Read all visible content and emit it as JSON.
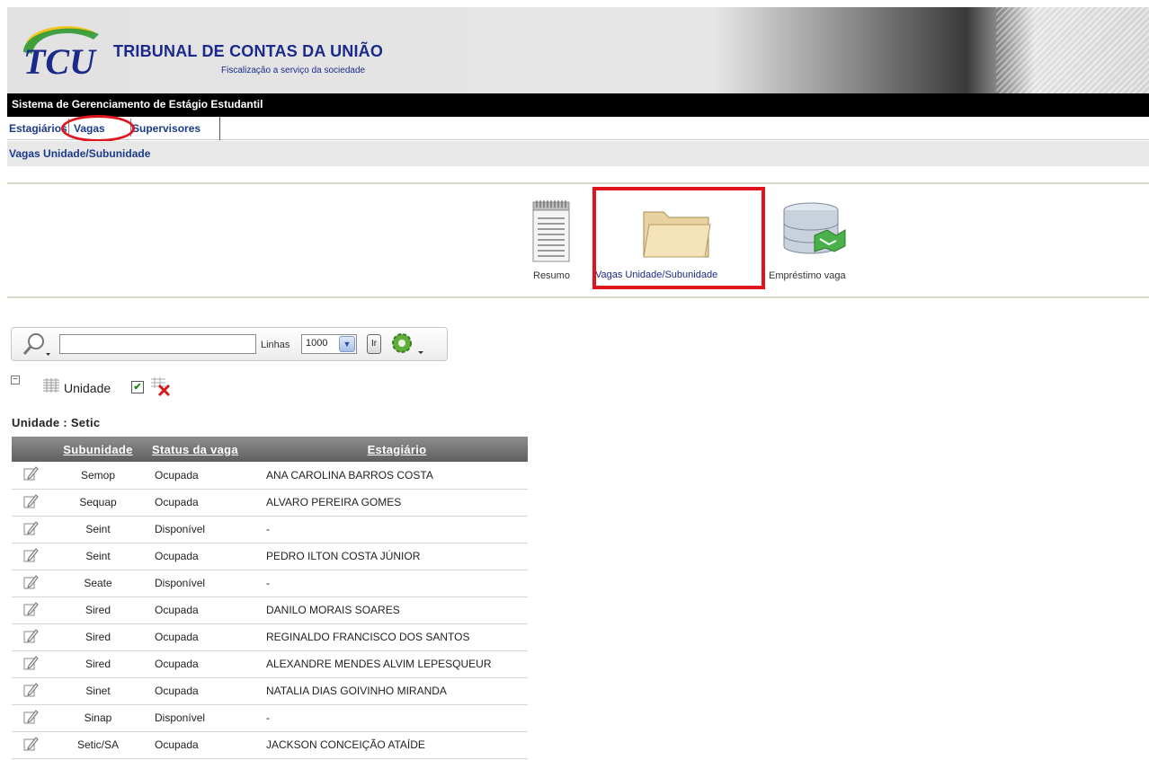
{
  "header": {
    "org_title": "TRIBUNAL DE CONTAS DA UNIÃO",
    "org_subtitle": "Fiscalização a serviço da sociedade",
    "logo_text": "TCU"
  },
  "system_bar": {
    "title": "Sistema de Gerenciamento de Estágio Estudantil"
  },
  "tabs": [
    {
      "label": "Estagiários"
    },
    {
      "label": "Vagas"
    },
    {
      "label": "Supervisores"
    }
  ],
  "breadcrumb": {
    "label": "Vagas Unidade/Subunidade"
  },
  "icon_menu": [
    {
      "label": "Resumo",
      "icon": "notepad-icon"
    },
    {
      "label": "Vagas Unidade/Subunidade",
      "icon": "folder-icon"
    },
    {
      "label": "Empréstimo vaga",
      "icon": "database-handshake-icon"
    }
  ],
  "toolbar": {
    "search_value": "",
    "rows_label": "Linhas",
    "rows_value": "1000",
    "go_label": "Ir"
  },
  "break_controls": {
    "label": "Unidade",
    "collapse_symbol": "−",
    "checked_symbol": "✔"
  },
  "group": {
    "title": "Unidade : Setic"
  },
  "table": {
    "headers": [
      "Subunidade",
      "Status da vaga",
      "Estagiário"
    ],
    "rows": [
      {
        "subunidade": "Semop",
        "status": "Ocupada",
        "estagiario": "ANA CAROLINA BARROS COSTA"
      },
      {
        "subunidade": "Sequap",
        "status": "Ocupada",
        "estagiario": "ALVARO PEREIRA GOMES"
      },
      {
        "subunidade": "Seint",
        "status": "Disponível",
        "estagiario": "-"
      },
      {
        "subunidade": "Seint",
        "status": "Ocupada",
        "estagiario": "PEDRO ILTON COSTA JÚNIOR"
      },
      {
        "subunidade": "Seate",
        "status": "Disponível",
        "estagiario": "-"
      },
      {
        "subunidade": "Sired",
        "status": "Ocupada",
        "estagiario": "DANILO MORAIS SOARES"
      },
      {
        "subunidade": "Sired",
        "status": "Ocupada",
        "estagiario": "REGINALDO FRANCISCO DOS SANTOS"
      },
      {
        "subunidade": "Sired",
        "status": "Ocupada",
        "estagiario": "ALEXANDRE MENDES ALVIM LEPESQUEUR"
      },
      {
        "subunidade": "Sinet",
        "status": "Ocupada",
        "estagiario": "NATALIA DIAS GOIVINHO MIRANDA"
      },
      {
        "subunidade": "Sinap",
        "status": "Disponível",
        "estagiario": "-"
      },
      {
        "subunidade": "Setic/SA",
        "status": "Ocupada",
        "estagiario": "JACKSON CONCEIÇÃO ATAÍDE"
      }
    ]
  },
  "colors": {
    "brand_blue": "#1b2a8a",
    "link_blue": "#1b3a8c",
    "highlight_red": "#e0141e",
    "logo_green": "#2f9a3a",
    "logo_yellow": "#f2c41a"
  }
}
